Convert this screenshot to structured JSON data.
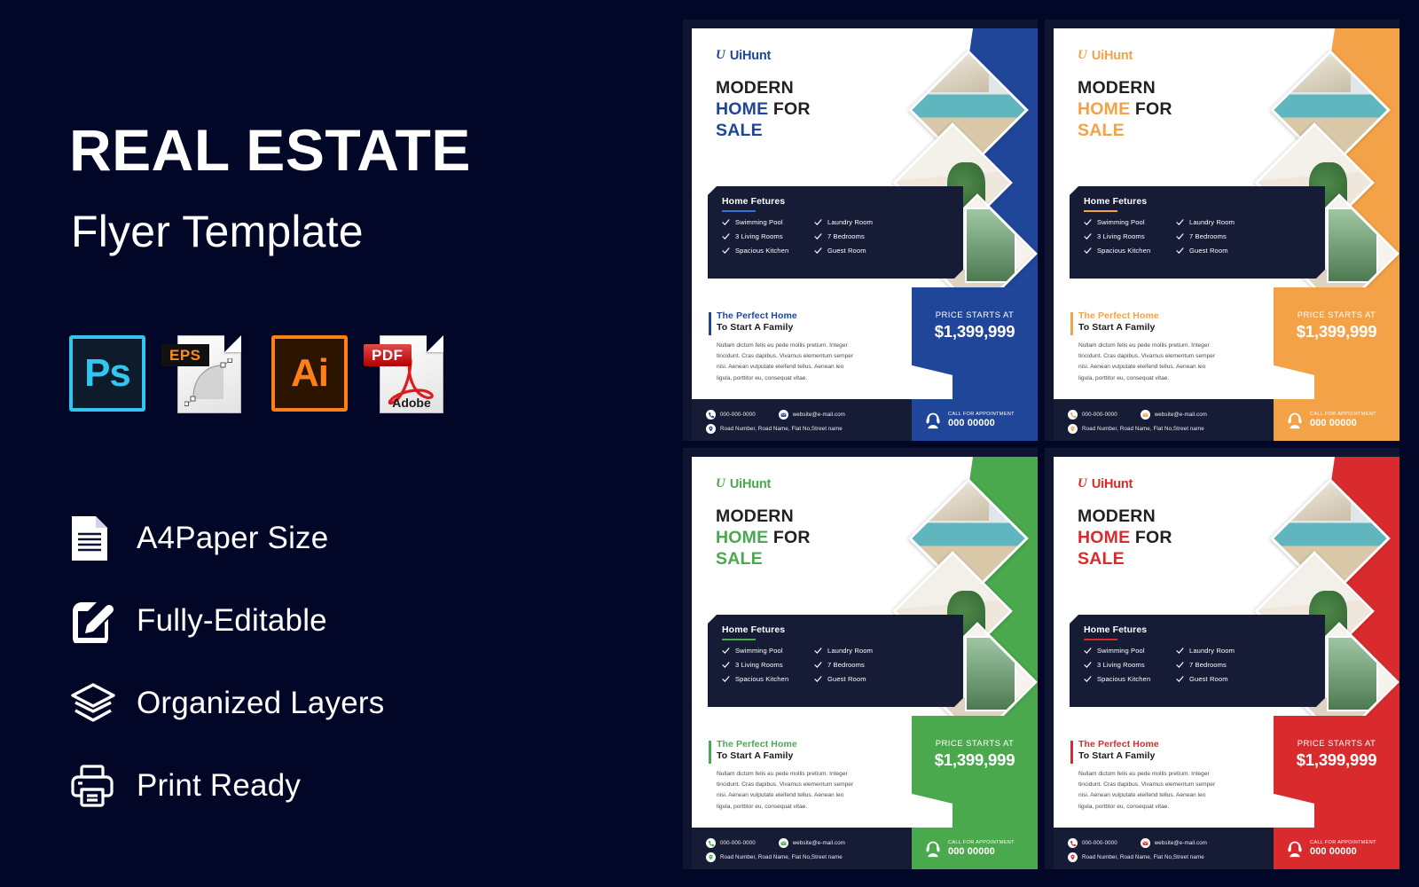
{
  "background_color": "#030727",
  "left_panel": {
    "title_main": "REAL ESTATE",
    "title_sub": "Flyer Template",
    "formats": [
      {
        "id": "ps",
        "label": "Ps",
        "icon": "photoshop-file-icon",
        "color": "#31c5f0"
      },
      {
        "id": "eps",
        "label": "EPS",
        "icon": "eps-file-icon",
        "color": "#ff8a1e"
      },
      {
        "id": "ai",
        "label": "Ai",
        "icon": "illustrator-file-icon",
        "color": "#ff7f18"
      },
      {
        "id": "pdf",
        "label": "PDF",
        "icon": "pdf-file-icon",
        "color": "#d01b1b",
        "sublabel": "Adobe"
      }
    ],
    "features": [
      {
        "label": "A4Paper Size",
        "icon": "document-icon"
      },
      {
        "label": "Fully-Editable",
        "icon": "edit-pencil-icon"
      },
      {
        "label": "Organized Layers",
        "icon": "layers-icon"
      },
      {
        "label": "Print Ready",
        "icon": "printer-icon"
      }
    ]
  },
  "flyer_common": {
    "logo_mark": "U",
    "logo_text": "UiHunt",
    "headline_line1": "MODERN",
    "headline_line2_accent": "HOME",
    "headline_line2_rest": " FOR",
    "headline_line3": "SALE",
    "features_title": "Home Fetures",
    "features": [
      "Swimming Pool",
      "Laundry Room",
      "3 Living Rooms",
      "7 Bedrooms",
      "Spacious Kitchen",
      "Guest Room"
    ],
    "price_label": "PRICE STARTS AT",
    "price_value": "$1,399,999",
    "pitch_line1": "The Perfect Home",
    "pitch_line2": "To Start A Family",
    "pitch_body": "Nullam dictum felis eu pede mollis pretium. Integer tincidunt. Cras dapibus. Vivamus elementum semper nisi. Aenean vulputate eleifend tellus. Aenean leo ligula, porttitor eu, consequat vitae.",
    "contact_phone": "000-000-0000",
    "contact_email": "website@e-mail.com",
    "contact_address": "Road Number, Road Name, Flat No,Street name",
    "cta_label": "CALL FOR APPOINTMENT",
    "cta_number": "000 00000"
  },
  "flyers": [
    {
      "variant": "blue",
      "accent": "#1f4698",
      "accent_dark": "#1b3c85"
    },
    {
      "variant": "orange",
      "accent": "#f3a248",
      "accent_dark": "#e8923a"
    },
    {
      "variant": "green",
      "accent": "#4aa84d",
      "accent_dark": "#3f9743"
    },
    {
      "variant": "red",
      "accent": "#d92b2e",
      "accent_dark": "#c42326"
    }
  ]
}
